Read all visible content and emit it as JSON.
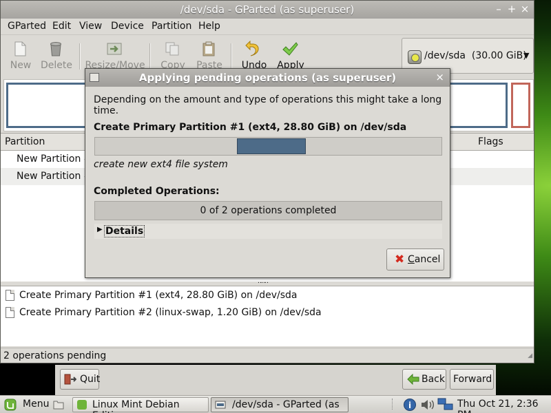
{
  "window": {
    "title": "/dev/sda - GParted (as superuser)",
    "controls": [
      "–",
      "+",
      "×"
    ]
  },
  "menu": [
    "GParted",
    "Edit",
    "View",
    "Device",
    "Partition",
    "Help"
  ],
  "toolbar": {
    "new": "New",
    "delete": "Delete",
    "resize_move": "Resize/Move",
    "copy": "Copy",
    "paste": "Paste",
    "undo": "Undo",
    "apply": "Apply"
  },
  "device_selector": {
    "device": "/dev/sda",
    "size": "(30.00 GiB)"
  },
  "partition_table": {
    "columns": [
      "Partition",
      "Flags"
    ],
    "rows": [
      "New Partition #",
      "New Partition #"
    ]
  },
  "pending_operations": [
    "Create Primary Partition #1 (ext4, 28.80 GiB) on /dev/sda",
    "Create Primary Partition #2 (linux-swap, 1.20 GiB) on /dev/sda"
  ],
  "status": "2 operations pending",
  "dialog": {
    "title": "Applying pending operations (as superuser)",
    "description": "Depending on the amount and type of operations this might take a long time.",
    "current_operation": "Create Primary Partition #1 (ext4, 28.80 GiB) on /dev/sda",
    "progress_fraction": 0.2,
    "current_step": "create new ext4 file system",
    "completed_label": "Completed Operations:",
    "completed_status": "0 of 2 operations completed",
    "details_label": "Details",
    "cancel_label": "Cancel",
    "cancel_mnemonic": "C",
    "cancel_rest": "ancel"
  },
  "installer": {
    "quit": "Quit",
    "back": "Back",
    "forward": "Forward"
  },
  "taskbar": {
    "menu": "Menu",
    "tasks": [
      "Linux Mint Debian Editi...",
      "/dev/sda - GParted (as ..."
    ],
    "clock": "Thu Oct 21,  2:36 PM"
  },
  "colors": {
    "progress_fill": "#4d6b88",
    "partition_ext4": "#4d6b88",
    "partition_swap": "#c1665a",
    "mint_green": "#6fb43a"
  }
}
